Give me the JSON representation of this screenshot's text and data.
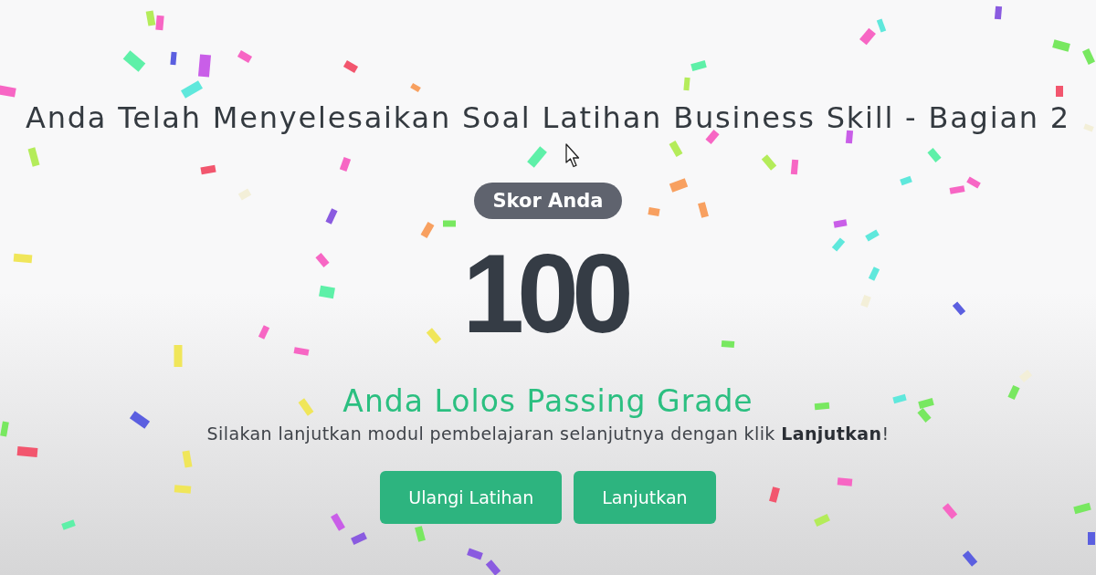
{
  "title": "Anda Telah Menyelesaikan Soal Latihan Business Skill - Bagian 2",
  "score": {
    "label": "Skor Anda",
    "value": "100"
  },
  "result": {
    "heading": "Anda Lolos Passing Grade",
    "message": "Silakan lanjutkan modul pembelajaran selanjutnya dengan klik **Lanjutkan**!"
  },
  "buttons": [
    {
      "label": "Ulangi Latihan"
    },
    {
      "label": "Lanjutkan"
    }
  ]
}
